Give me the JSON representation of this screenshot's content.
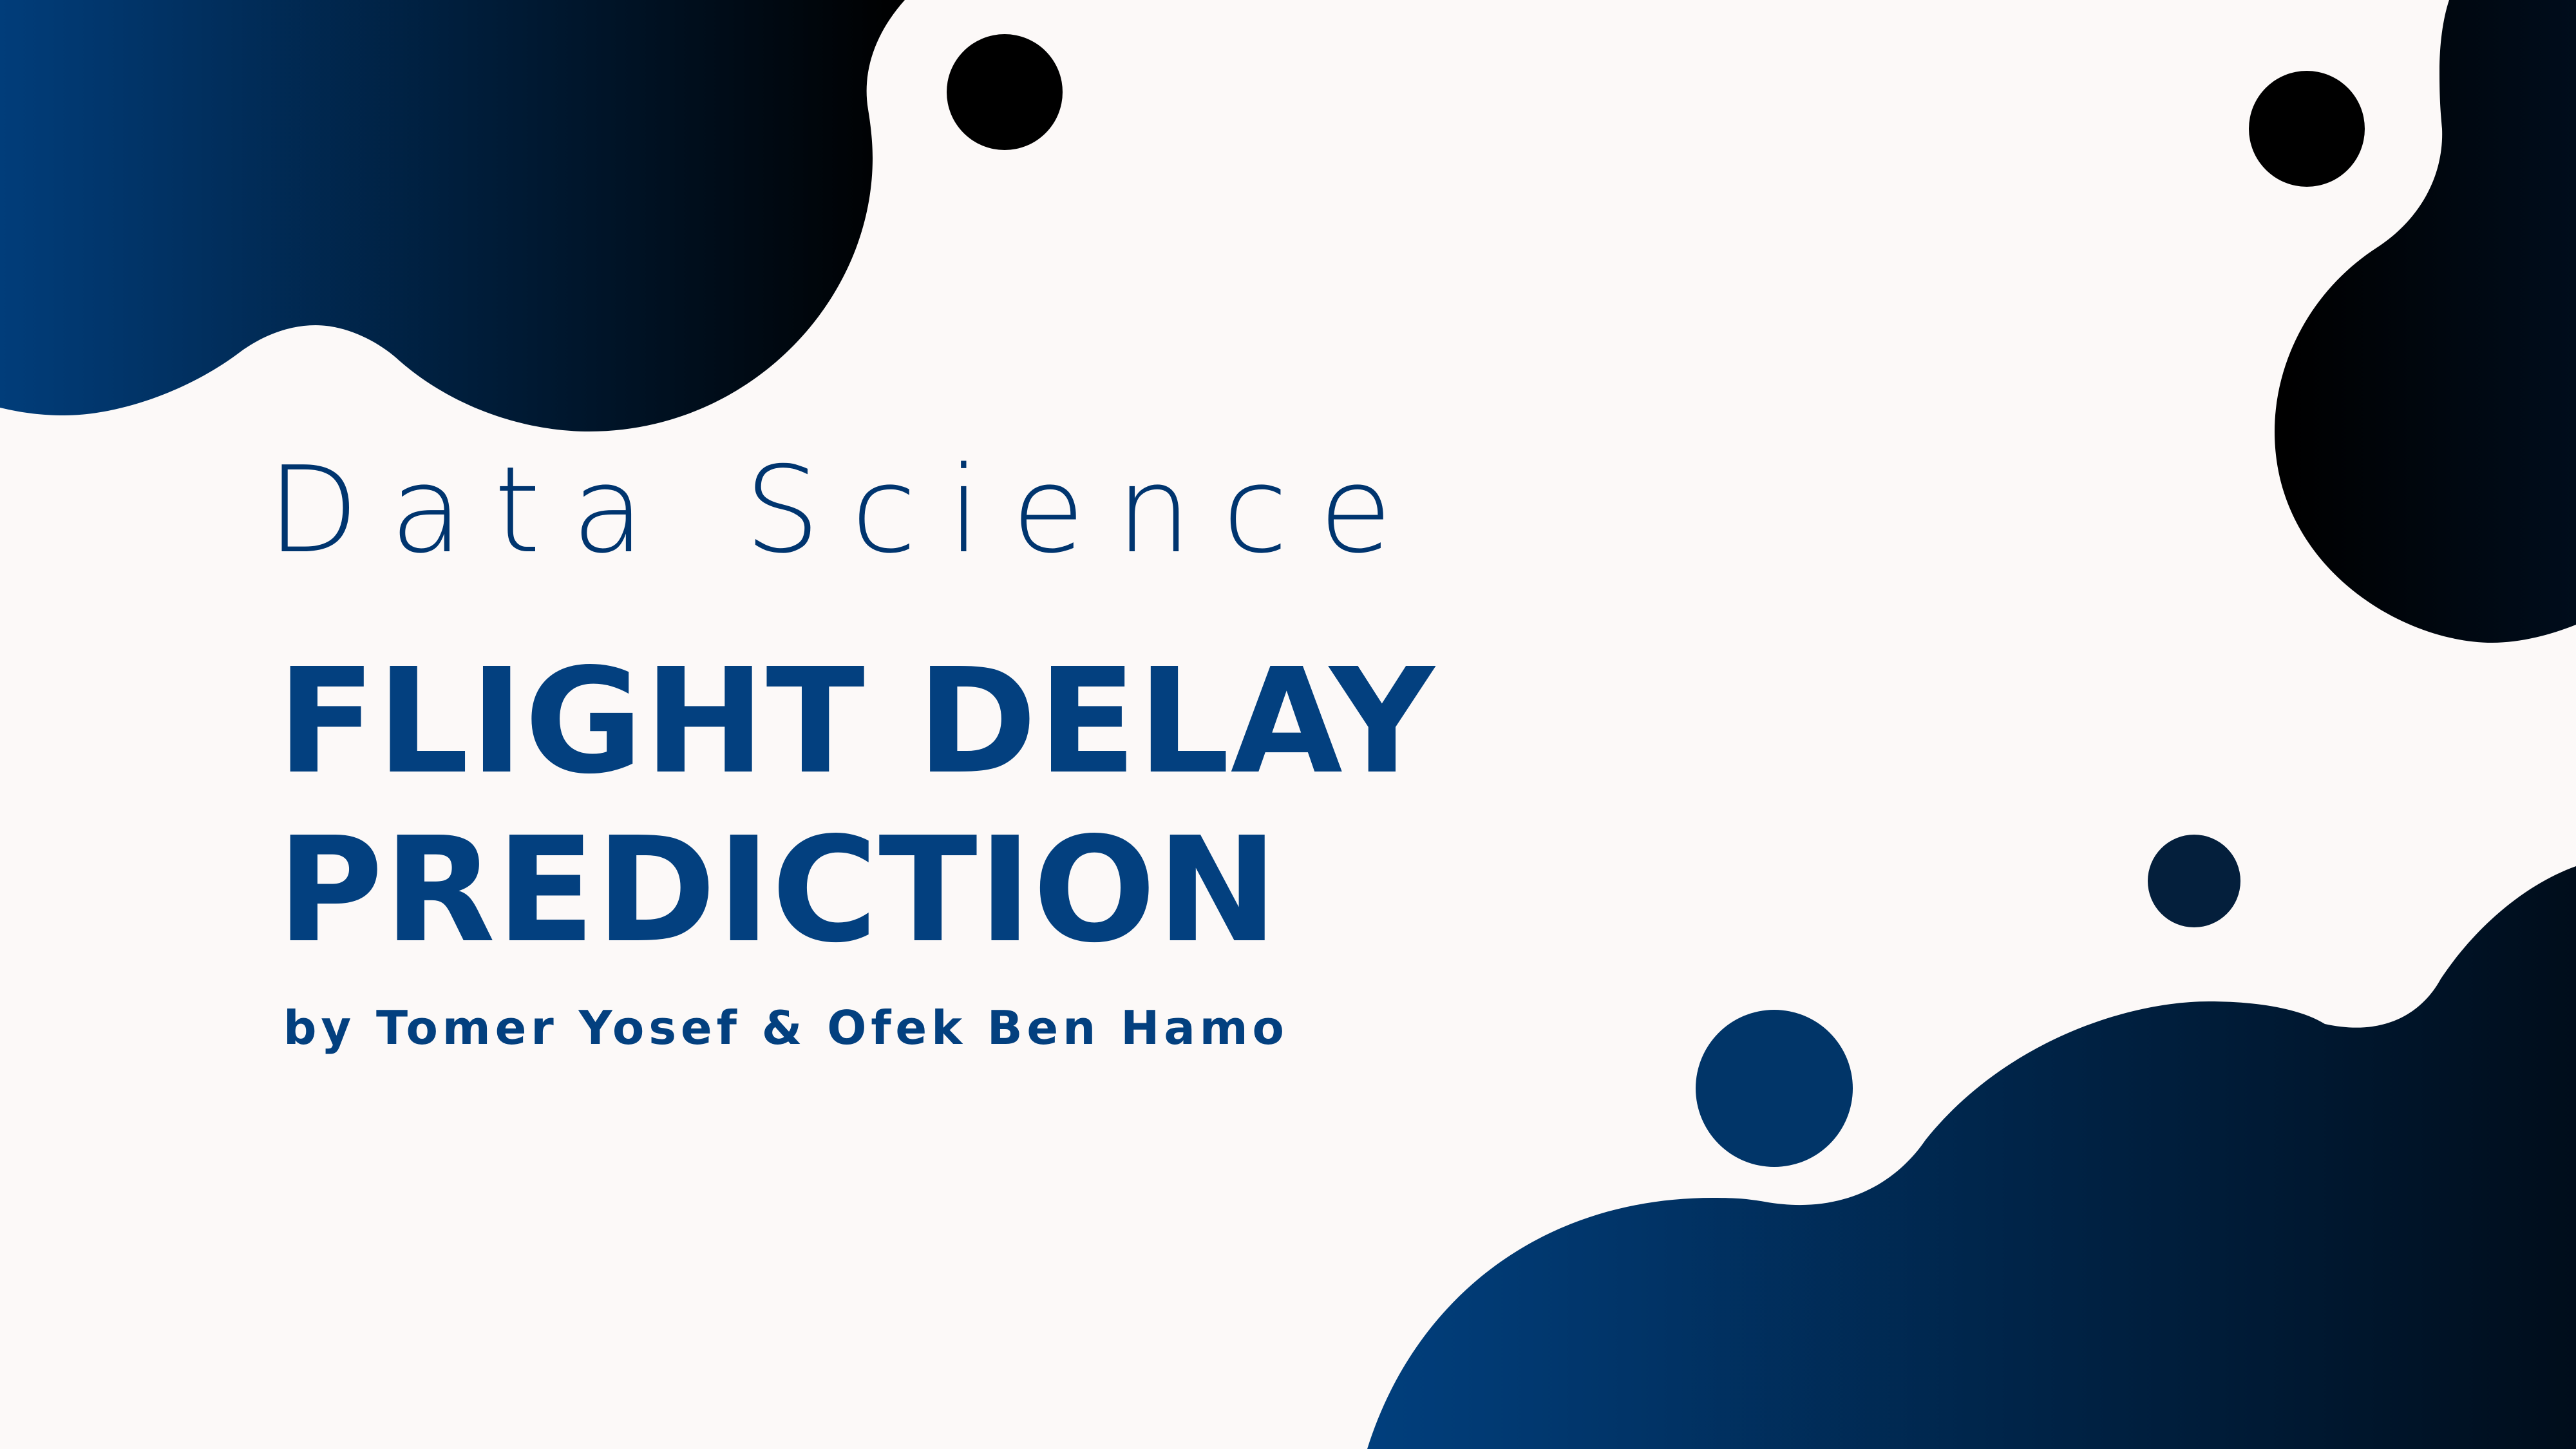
{
  "slide": {
    "kicker": "Data Science",
    "title_line_1": "FLIGHT DELAY",
    "title_line_2": "PREDICTION",
    "byline": "by Tomer Yosef & Ofek Ben Hamo"
  },
  "colors": {
    "background": "#fcf9f8",
    "text_primary": "#03407f",
    "blob_gradient_light": "#013d7a",
    "blob_gradient_dark": "#000000"
  }
}
